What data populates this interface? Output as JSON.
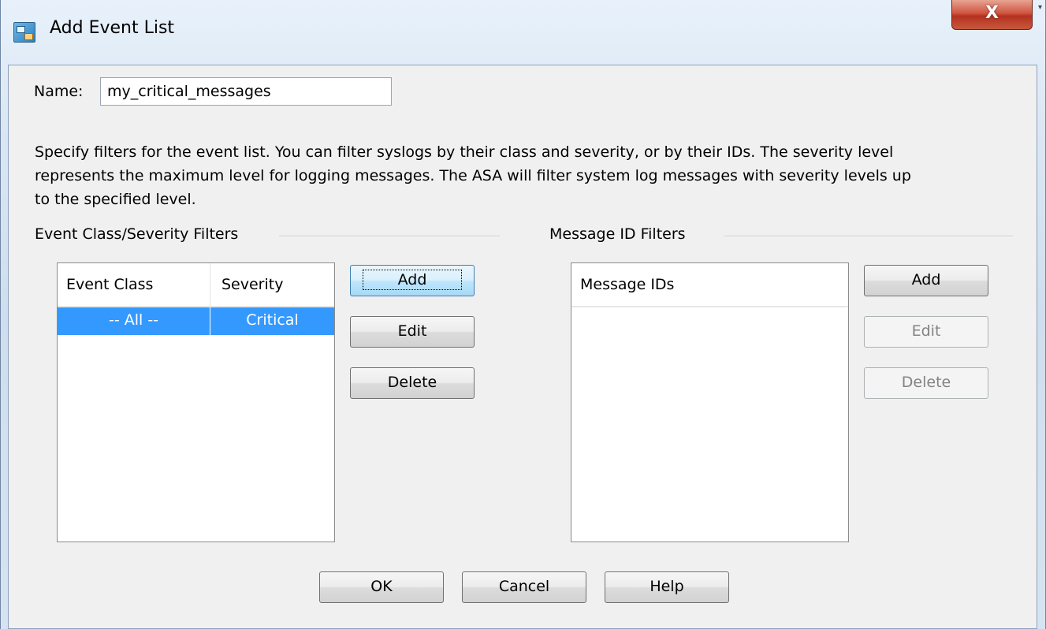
{
  "window": {
    "title": "Add Event List",
    "close_label": "X"
  },
  "form": {
    "name_label": "Name:",
    "name_value": "my_critical_messages",
    "description_lines": [
      "Specify filters for the event list. You can filter syslogs by their class and severity, or by their IDs. The severity level",
      "represents the maximum level for logging messages. The ASA will filter system log messages with severity levels up",
      "to the specified level."
    ]
  },
  "event_class_group": {
    "title": "Event Class/Severity Filters",
    "columns": [
      "Event Class",
      "Severity"
    ],
    "rows": [
      {
        "event_class": "-- All --",
        "severity": "Critical",
        "selected": true
      }
    ],
    "buttons": {
      "add": "Add",
      "edit": "Edit",
      "delete": "Delete"
    }
  },
  "message_id_group": {
    "title": "Message ID Filters",
    "columns": [
      "Message IDs"
    ],
    "rows": [],
    "buttons": {
      "add": "Add",
      "edit": "Edit",
      "delete": "Delete"
    },
    "edit_enabled": false,
    "delete_enabled": false
  },
  "footer": {
    "ok": "OK",
    "cancel": "Cancel",
    "help": "Help"
  },
  "colors": {
    "selection": "#3399ff",
    "close_button": "#c8452f",
    "dialog_bg": "#f0f0f0"
  }
}
